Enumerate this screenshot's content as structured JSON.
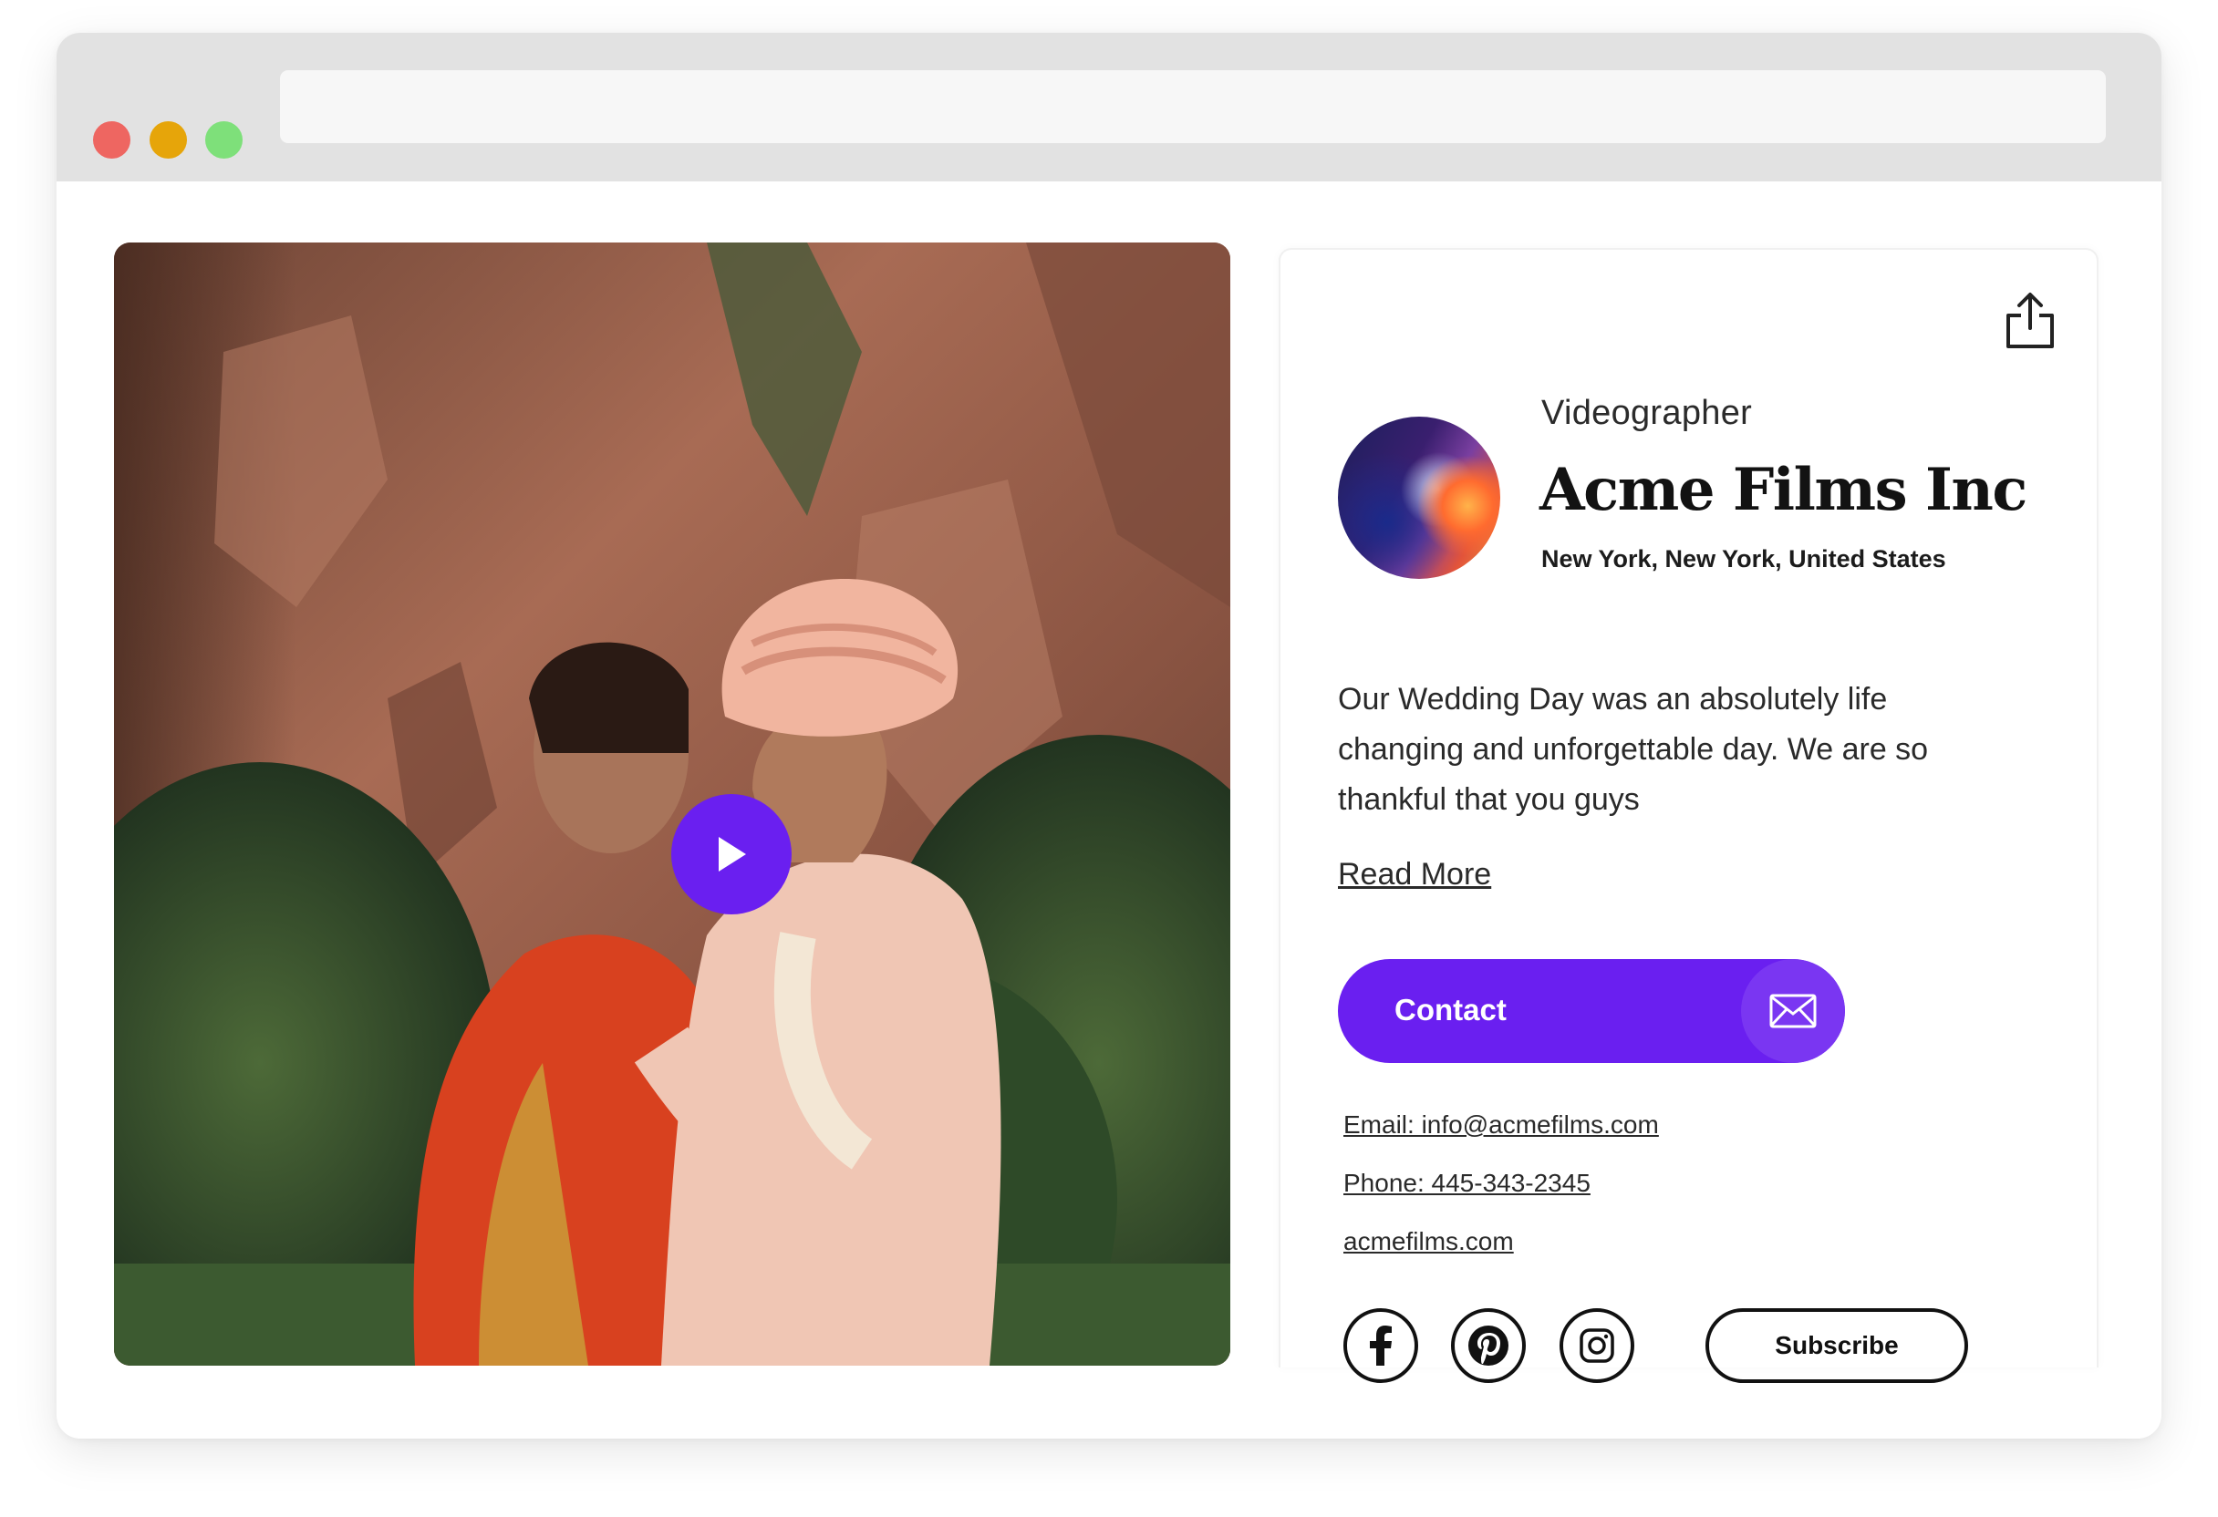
{
  "window": {
    "traffic_lights": [
      "close",
      "minimize",
      "maximize"
    ],
    "url": ""
  },
  "hero": {
    "image_subject": "wedding couple embracing in front of red rock cliffs",
    "play_icon": "play-icon",
    "accent_color": "#6a1ff0"
  },
  "profile": {
    "role": "Videographer",
    "name": "Acme Films Inc",
    "location": "New York, New York, United States",
    "bio": "Our Wedding Day was an absolutely life changing and unforgettable day. We are so thankful that you guys",
    "read_more": "Read More",
    "share_icon": "share-icon",
    "contact": {
      "label": "Contact",
      "icon": "mail-icon",
      "color": "#6a1ff0"
    },
    "links": {
      "email": "Email: info@acmefilms.com",
      "phone": "Phone: 445-343-2345",
      "website": "acmefilms.com"
    },
    "social": [
      "facebook-icon",
      "pinterest-icon",
      "instagram-icon"
    ],
    "subscribe": "Subscribe"
  }
}
